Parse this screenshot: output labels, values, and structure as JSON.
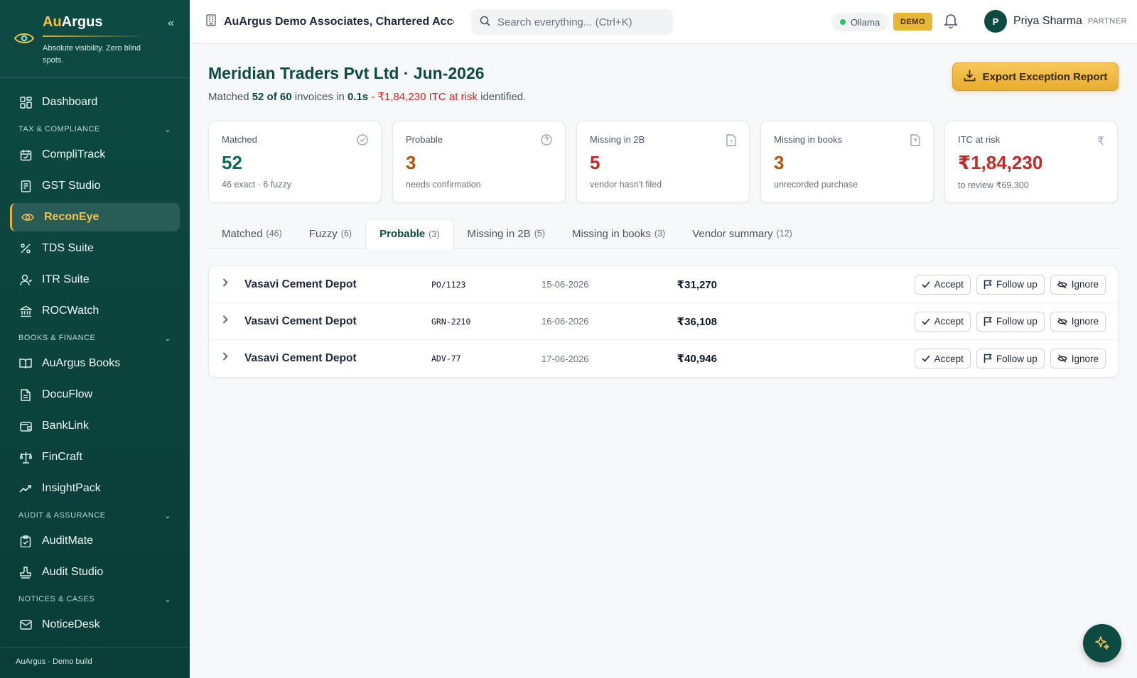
{
  "brand": {
    "name_prefix": "Au",
    "name_suffix": "Argus",
    "tagline": "Absolute visibility. Zero blind spots."
  },
  "sidebar": {
    "collapse_label": "«",
    "items": [
      {
        "label": "Dashboard",
        "icon": "grid-icon"
      },
      {
        "label": "CompliTrack",
        "icon": "calendar-check-icon"
      },
      {
        "label": "GST Studio",
        "icon": "receipt-icon"
      },
      {
        "label": "ReconEye",
        "icon": "eye-icon",
        "active": true
      },
      {
        "label": "TDS Suite",
        "icon": "percent-icon"
      },
      {
        "label": "ITR Suite",
        "icon": "user-icon"
      },
      {
        "label": "ROCWatch",
        "icon": "bank-icon"
      },
      {
        "label": "AuArgus Books",
        "icon": "book-open-icon"
      },
      {
        "label": "DocuFlow",
        "icon": "document-icon"
      },
      {
        "label": "BankLink",
        "icon": "wallet-icon"
      },
      {
        "label": "FinCraft",
        "icon": "scale-icon"
      },
      {
        "label": "InsightPack",
        "icon": "trending-up-icon"
      },
      {
        "label": "AuditMate",
        "icon": "clipboard-check-icon"
      },
      {
        "label": "Audit Studio",
        "icon": "stamp-icon"
      },
      {
        "label": "NoticeDesk",
        "icon": "mail-icon"
      }
    ],
    "sections": {
      "tax": "TAX & COMPLIANCE",
      "books": "BOOKS & FINANCE",
      "audit": "AUDIT & ASSURANCE",
      "notices": "NOTICES & CASES"
    },
    "footer": "AuArgus · Demo build"
  },
  "topbar": {
    "org_name": "AuArgus Demo Associates, Chartered Accou...",
    "search_placeholder": "Search everything...  (Ctrl+K)",
    "ollama_label": "Ollama",
    "demo_badge": "DEMO",
    "user_initial": "P",
    "user_name": "Priya Sharma",
    "user_role": "PARTNER"
  },
  "page": {
    "title": "Meridian Traders Pvt Ltd · Jun-2026",
    "subtitle_prefix": "Matched ",
    "subtitle_matched": "52 of 60",
    "subtitle_mid": " invoices in ",
    "subtitle_time": "0.1s",
    "subtitle_sep": " - ",
    "subtitle_risk": "₹1,84,230 ITC at risk",
    "subtitle_suffix": " identified.",
    "export_label": "Export Exception Report"
  },
  "cards": [
    {
      "label": "Matched",
      "value": "52",
      "sub": "46 exact · 6 fuzzy",
      "color": "#0d6b57",
      "icon": "check-circle-icon"
    },
    {
      "label": "Probable",
      "value": "3",
      "sub": "needs confirmation",
      "color": "#b45309",
      "icon": "help-circle-icon"
    },
    {
      "label": "Missing in 2B",
      "value": "5",
      "sub": "vendor hasn't filed",
      "color": "#c62828",
      "icon": "file-icon"
    },
    {
      "label": "Missing in books",
      "value": "3",
      "sub": "unrecorded purchase",
      "color": "#b45309",
      "icon": "file-question-icon"
    },
    {
      "label": "ITC at risk",
      "value": "₹1,84,230",
      "sub": "to review ₹69,300",
      "color": "#c62828",
      "icon": "rupee-icon"
    }
  ],
  "tabs": [
    {
      "label": "Matched",
      "count": "(46)"
    },
    {
      "label": "Fuzzy",
      "count": "(6)"
    },
    {
      "label": "Probable",
      "count": "(3)",
      "active": true
    },
    {
      "label": "Missing in 2B",
      "count": "(5)"
    },
    {
      "label": "Missing in books",
      "count": "(3)"
    },
    {
      "label": "Vendor summary",
      "count": "(12)"
    }
  ],
  "rows": [
    {
      "vendor": "Vasavi Cement Depot",
      "ref": "PO/1123",
      "date": "15-06-2026",
      "amount": "₹31,270"
    },
    {
      "vendor": "Vasavi Cement Depot",
      "ref": "GRN-2210",
      "date": "16-06-2026",
      "amount": "₹36,108"
    },
    {
      "vendor": "Vasavi Cement Depot",
      "ref": "ADV-77",
      "date": "17-06-2026",
      "amount": "₹40,946"
    }
  ],
  "row_actions": {
    "accept": "Accept",
    "follow_up": "Follow up",
    "ignore": "Ignore"
  },
  "colors": {
    "brand": "#0d4a42",
    "accent": "#e8b539",
    "danger": "#c62828",
    "warning": "#b45309"
  }
}
